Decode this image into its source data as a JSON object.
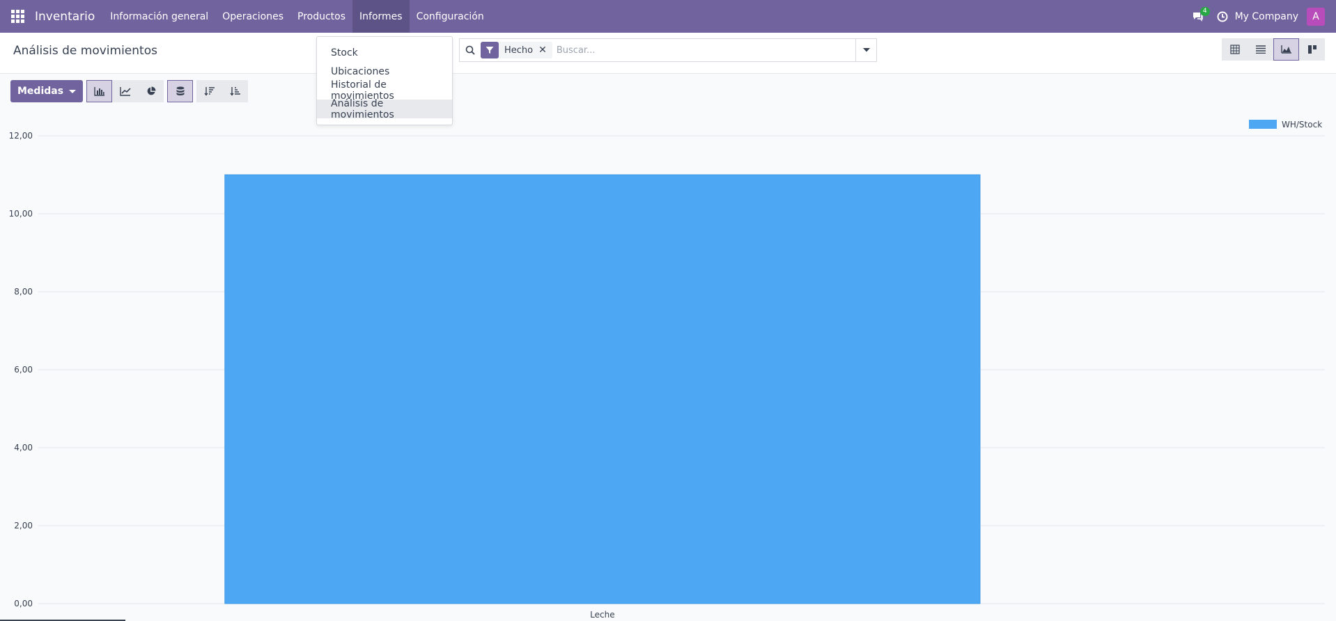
{
  "navbar": {
    "brand": "Inventario",
    "menu": [
      {
        "label": "Información general"
      },
      {
        "label": "Operaciones"
      },
      {
        "label": "Productos"
      },
      {
        "label": "Informes"
      },
      {
        "label": "Configuración"
      }
    ],
    "chat_count": "4",
    "company": "My Company",
    "avatar_initial": "A"
  },
  "page": {
    "title": "Análisis de movimientos"
  },
  "search": {
    "facet_label": "Hecho",
    "placeholder": "Buscar..."
  },
  "toolbar": {
    "measures_label": "Medidas"
  },
  "dropdown": {
    "items": [
      {
        "label": "Stock"
      },
      {
        "label": "Ubicaciones"
      },
      {
        "label": "Historial de movimientos"
      },
      {
        "label": "Análisis de movimientos"
      }
    ]
  },
  "colors": {
    "brand": "#71639e",
    "bar": "#4ea7f2"
  },
  "chart_data": {
    "type": "bar",
    "categories": [
      "Leche"
    ],
    "series": [
      {
        "name": "WH/Stock",
        "values": [
          11
        ]
      }
    ],
    "ylim": [
      0,
      12
    ],
    "yticks": [
      "0,00",
      "2,00",
      "4,00",
      "6,00",
      "8,00",
      "10,00",
      "12,00"
    ],
    "grid": true,
    "legend_position": "top-right"
  }
}
